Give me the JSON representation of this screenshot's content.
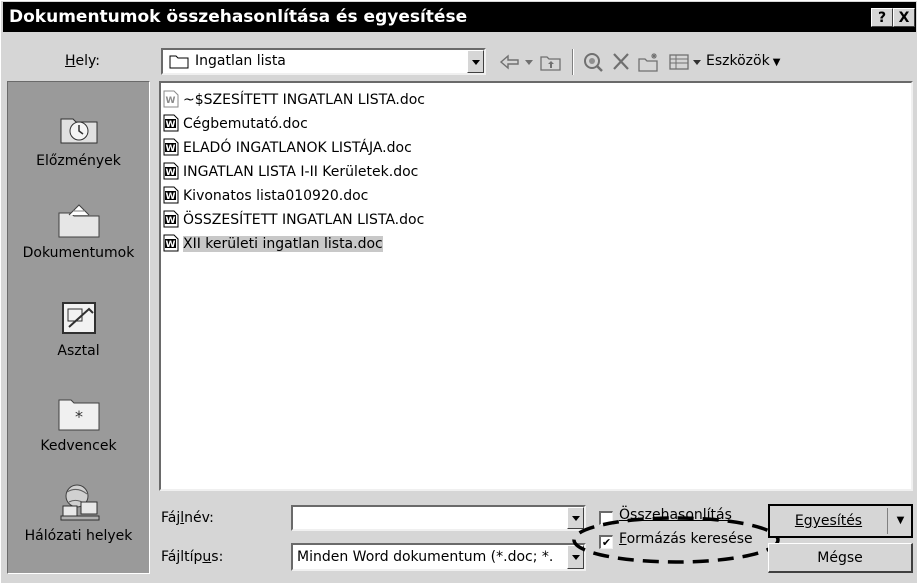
{
  "window": {
    "title": "Dokumentumok összehasonlítása és egyesítése",
    "help_label": "?",
    "close_label": "X"
  },
  "location": {
    "label": "Hely:",
    "value": "Ingatlan lista"
  },
  "toolbar": {
    "tools_label": "Eszközök"
  },
  "places": [
    {
      "label": "Előzmények",
      "icon": "history-icon"
    },
    {
      "label": "Dokumentumok",
      "icon": "documents-folder-icon"
    },
    {
      "label": "Asztal",
      "icon": "desktop-icon"
    },
    {
      "label": "Kedvencek",
      "icon": "favorites-icon"
    },
    {
      "label": "Hálózati helyek",
      "icon": "network-places-icon"
    }
  ],
  "files": [
    {
      "name": "~$SZESÍTETT INGATLAN LISTA.doc",
      "selected": false,
      "hidden": true
    },
    {
      "name": "Cégbemutató.doc",
      "selected": false
    },
    {
      "name": "ELADÓ INGATLANOK LISTÁJA.doc",
      "selected": false
    },
    {
      "name": "INGATLAN LISTA I-II Kerületek.doc",
      "selected": false
    },
    {
      "name": "Kivonatos lista010920.doc",
      "selected": false
    },
    {
      "name": "ÖSSZESÍTETT INGATLAN LISTA.doc",
      "selected": false
    },
    {
      "name": "XII kerületi ingatlan lista.doc",
      "selected": true
    }
  ],
  "filename": {
    "label": "Fájlnév:",
    "value": ""
  },
  "filetype": {
    "label": "Fájltípus:",
    "value": "Minden Word dokumentum (*.doc; *."
  },
  "options": {
    "compare_label": "Összehasonlítás",
    "compare_checked": false,
    "find_formatting_label": "Formázás keresése",
    "find_formatting_checked": true,
    "check_mark": "✔"
  },
  "buttons": {
    "merge_label": "Egyesítés",
    "cancel_label": "Mégse"
  }
}
